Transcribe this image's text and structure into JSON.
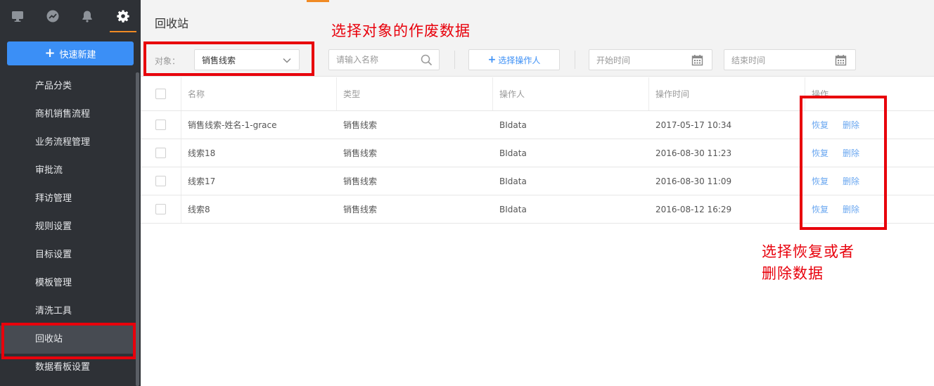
{
  "sidebar": {
    "top_icons": [
      "monitor-icon",
      "trend-icon",
      "bell-icon",
      "gear-icon"
    ],
    "quick_new": "快速新建",
    "items": [
      "产品分类",
      "商机销售流程",
      "业务流程管理",
      "审批流",
      "拜访管理",
      "规则设置",
      "目标设置",
      "模板管理",
      "清洗工具",
      "回收站",
      "数据看板设置"
    ],
    "active_item": "回收站"
  },
  "page": {
    "title": "回收站",
    "filter": {
      "object_label": "对象：",
      "object_value": "销售线索",
      "search_placeholder": "请输入名称",
      "operator_button": "选择操作人",
      "start_placeholder": "开始时间",
      "end_placeholder": "结束时间"
    }
  },
  "table": {
    "headers": [
      "名称",
      "类型",
      "操作人",
      "操作时间",
      "操作"
    ],
    "rows": [
      {
        "name": "销售线索-姓名-1-grace",
        "type": "销售线索",
        "operator": "BIdata",
        "time": "2017-05-17 10:34",
        "restore": "恢复",
        "delete": "删除"
      },
      {
        "name": "线索18",
        "type": "销售线索",
        "operator": "BIdata",
        "time": "2016-08-30 11:23",
        "restore": "恢复",
        "delete": "删除"
      },
      {
        "name": "线索17",
        "type": "销售线索",
        "operator": "BIdata",
        "time": "2016-08-30 11:09",
        "restore": "恢复",
        "delete": "删除"
      },
      {
        "name": "线索8",
        "type": "销售线索",
        "operator": "BIdata",
        "time": "2016-08-12 16:29",
        "restore": "恢复",
        "delete": "删除"
      }
    ]
  },
  "annotations": {
    "select_object": "选择对象的作废数据",
    "restore_line1": "选择恢复或者",
    "restore_line2": "删除数据"
  },
  "colors": {
    "primary": "#3b8ff6",
    "sidebar_bg": "#2e3136",
    "accent_orange": "#f08a24",
    "annotation_red": "#e8000b",
    "link_blue": "#6aa7f0"
  }
}
